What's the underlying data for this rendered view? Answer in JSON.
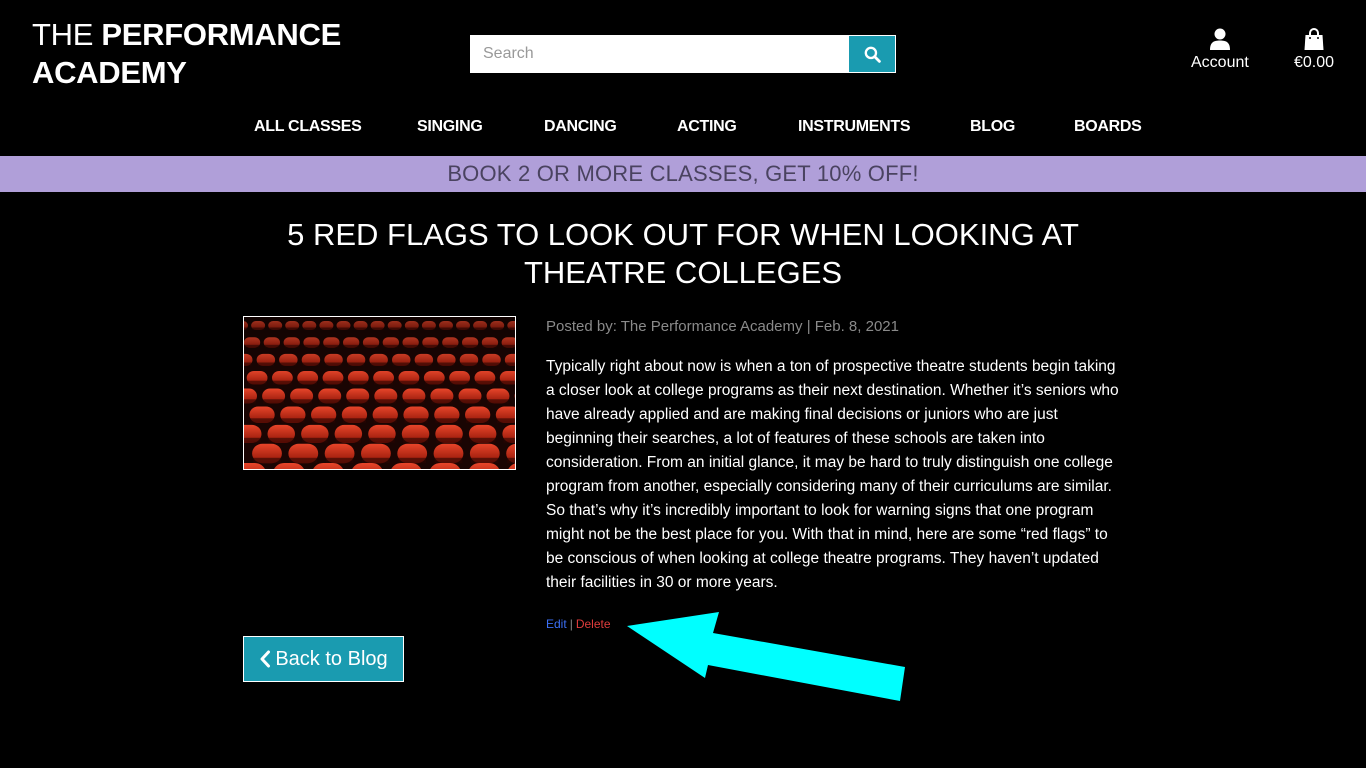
{
  "logo": {
    "line1_prefix": "THE ",
    "line1_bold": "PERFORMANCE",
    "line2": "ACADEMY"
  },
  "search": {
    "placeholder": "Search",
    "value": ""
  },
  "header_links": {
    "account": "Account",
    "cart_total": "€0.00"
  },
  "nav": [
    "ALL CLASSES",
    "SINGING",
    "DANCING",
    "ACTING",
    "INSTRUMENTS",
    "BLOG",
    "BOARDS"
  ],
  "banner": "BOOK 2 OR MORE CLASSES, GET 10% OFF!",
  "post": {
    "title": "5 RED FLAGS TO LOOK OUT FOR WHEN LOOKING AT THEATRE COLLEGES",
    "meta": "Posted by: The Performance Academy | Feb. 8, 2021",
    "body": "Typically right about now is when a ton of prospective theatre students begin taking a closer look at college programs as their next destination. Whether it’s seniors who have already applied and are making final decisions or juniors who are just beginning their searches, a lot of features of these schools are taken into consideration. From an initial glance, it may be hard to truly distinguish one college program from another, especially considering many of their curriculums are similar. So that’s why it’s incredibly important to look for warning signs that one program might not be the best place for you. With that in mind, here are some “red flags” to be conscious of when looking at college theatre programs. They haven’t updated their facilities in 30 or more years.",
    "edit_label": "Edit",
    "separator": "|",
    "delete_label": "Delete"
  },
  "back_button": "Back to Blog",
  "colors": {
    "accent": "#1a9bb0",
    "banner_bg": "#b09fd9",
    "banner_text": "#4a4360",
    "edit_link": "#3b6ff5",
    "delete_link": "#e03c3c",
    "annotation_arrow": "#00ffff",
    "seat_red": "#c7240f"
  },
  "icons": {
    "search": "search-icon",
    "account": "user-icon",
    "cart": "shopping-bag-icon",
    "back": "chevron-left-icon"
  }
}
